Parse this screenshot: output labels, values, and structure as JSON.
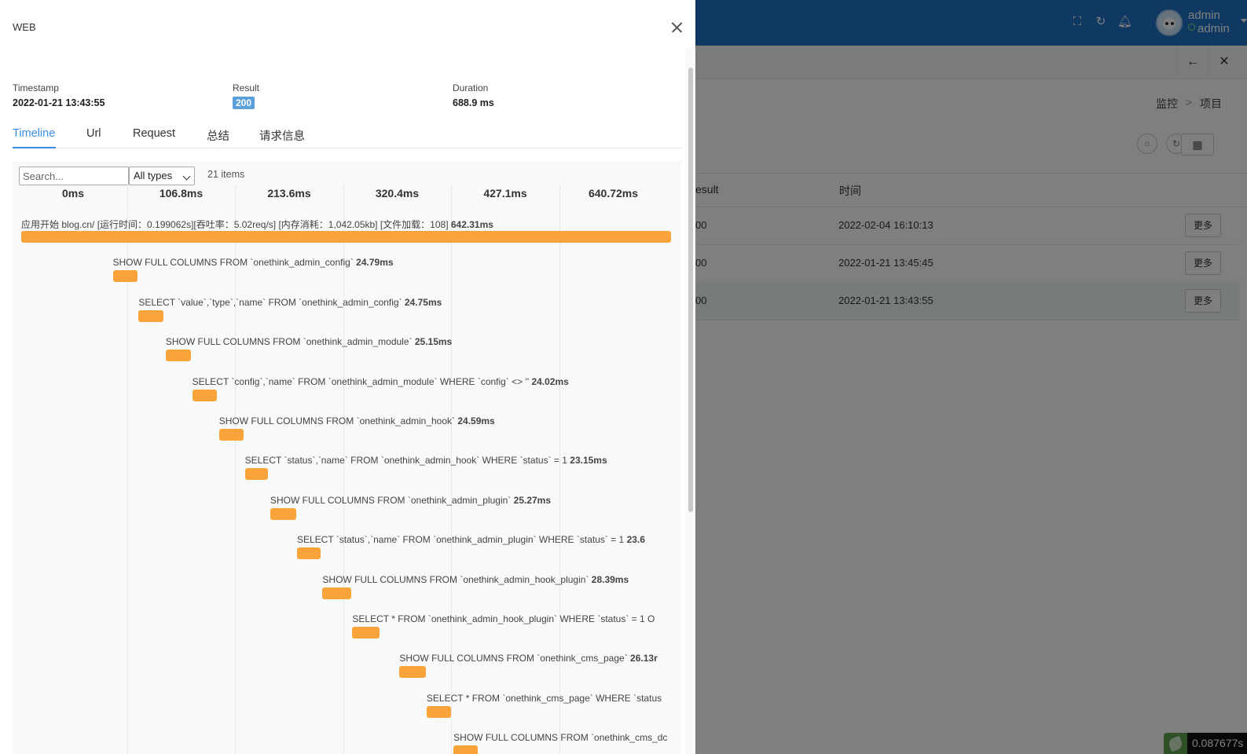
{
  "background": {
    "user": {
      "name": "admin",
      "status": "admin"
    },
    "breadcrumb": {
      "root": "监控",
      "sep": ">",
      "current": "项目"
    },
    "table": {
      "headers": {
        "result": "esult",
        "time": "时间"
      },
      "rows": [
        {
          "result": "00",
          "time": "2022-02-04 16:10:13",
          "action": "更多"
        },
        {
          "result": "00",
          "time": "2022-01-21 13:45:45",
          "action": "更多"
        },
        {
          "result": "00",
          "time": "2022-01-21 13:43:55",
          "action": "更多"
        }
      ]
    },
    "trace_time": "0.087677s"
  },
  "drawer": {
    "title": "WEB",
    "meta": {
      "timestamp_label": "Timestamp",
      "timestamp_value": "2022-01-21 13:43:55",
      "result_label": "Result",
      "result_value": "200",
      "duration_label": "Duration",
      "duration_value": "688.9 ms"
    },
    "tabs": [
      "Timeline",
      "Url",
      "Request",
      "总结",
      "请求信息"
    ],
    "active_tab": "Timeline",
    "timeline": {
      "search_placeholder": "Search...",
      "type_filter": "All types",
      "count_label": "21 items",
      "ticks": [
        "0ms",
        "106.8ms",
        "213.6ms",
        "320.4ms",
        "427.1ms",
        "640.72ms"
      ],
      "entries": [
        {
          "text": "应用开始 blog.cn/ [运行时间：0.199062s][吞吐率：5.02req/s] [内存消耗：1,042.05kb] [文件加载：108]",
          "duration": "642.31ms",
          "start_ms": 0,
          "dur_ms": 642.31
        },
        {
          "text": "SHOW FULL COLUMNS FROM `onethink_admin_config`",
          "duration": "24.79ms",
          "start_ms": 90.5,
          "dur_ms": 24.79
        },
        {
          "text": "SELECT `value`,`type`,`name` FROM `onethink_admin_config`",
          "duration": "24.75ms",
          "start_ms": 116.0,
          "dur_ms": 24.75
        },
        {
          "text": "SHOW FULL COLUMNS FROM `onethink_admin_module`",
          "duration": "25.15ms",
          "start_ms": 142.8,
          "dur_ms": 25.15
        },
        {
          "text": "SELECT `config`,`name` FROM `onethink_admin_module` WHERE `config` <> ''",
          "duration": "24.02ms",
          "start_ms": 169.0,
          "dur_ms": 24.02
        },
        {
          "text": "SHOW FULL COLUMNS FROM `onethink_admin_hook`",
          "duration": "24.59ms",
          "start_ms": 195.5,
          "dur_ms": 24.59
        },
        {
          "text": "SELECT `status`,`name` FROM `onethink_admin_hook` WHERE `status` = 1",
          "duration": "23.15ms",
          "start_ms": 221.1,
          "dur_ms": 23.15
        },
        {
          "text": "SHOW FULL COLUMNS FROM `onethink_admin_plugin`",
          "duration": "25.27ms",
          "start_ms": 246.2,
          "dur_ms": 25.27
        },
        {
          "text": "SELECT `status`,`name` FROM `onethink_admin_plugin` WHERE `status` = 1",
          "duration": "23.6",
          "start_ms": 272.6,
          "dur_ms": 23.6
        },
        {
          "text": "SHOW FULL COLUMNS FROM `onethink_admin_hook_plugin`",
          "duration": "28.39ms",
          "start_ms": 297.8,
          "dur_ms": 28.39
        },
        {
          "text": "SELECT * FROM `onethink_admin_hook_plugin` WHERE `status` = 1 O",
          "duration": "",
          "start_ms": 327.3,
          "dur_ms": 27.0
        },
        {
          "text": "SHOW FULL COLUMNS FROM `onethink_cms_page`",
          "duration": "26.13r",
          "start_ms": 373.9,
          "dur_ms": 26.13
        },
        {
          "text": "SELECT * FROM `onethink_cms_page` WHERE `status",
          "duration": "",
          "start_ms": 400.7,
          "dur_ms": 24.5
        },
        {
          "text": "SHOW FULL COLUMNS FROM `onethink_cms_dc",
          "duration": "",
          "start_ms": 427.3,
          "dur_ms": 24.0
        }
      ]
    }
  }
}
